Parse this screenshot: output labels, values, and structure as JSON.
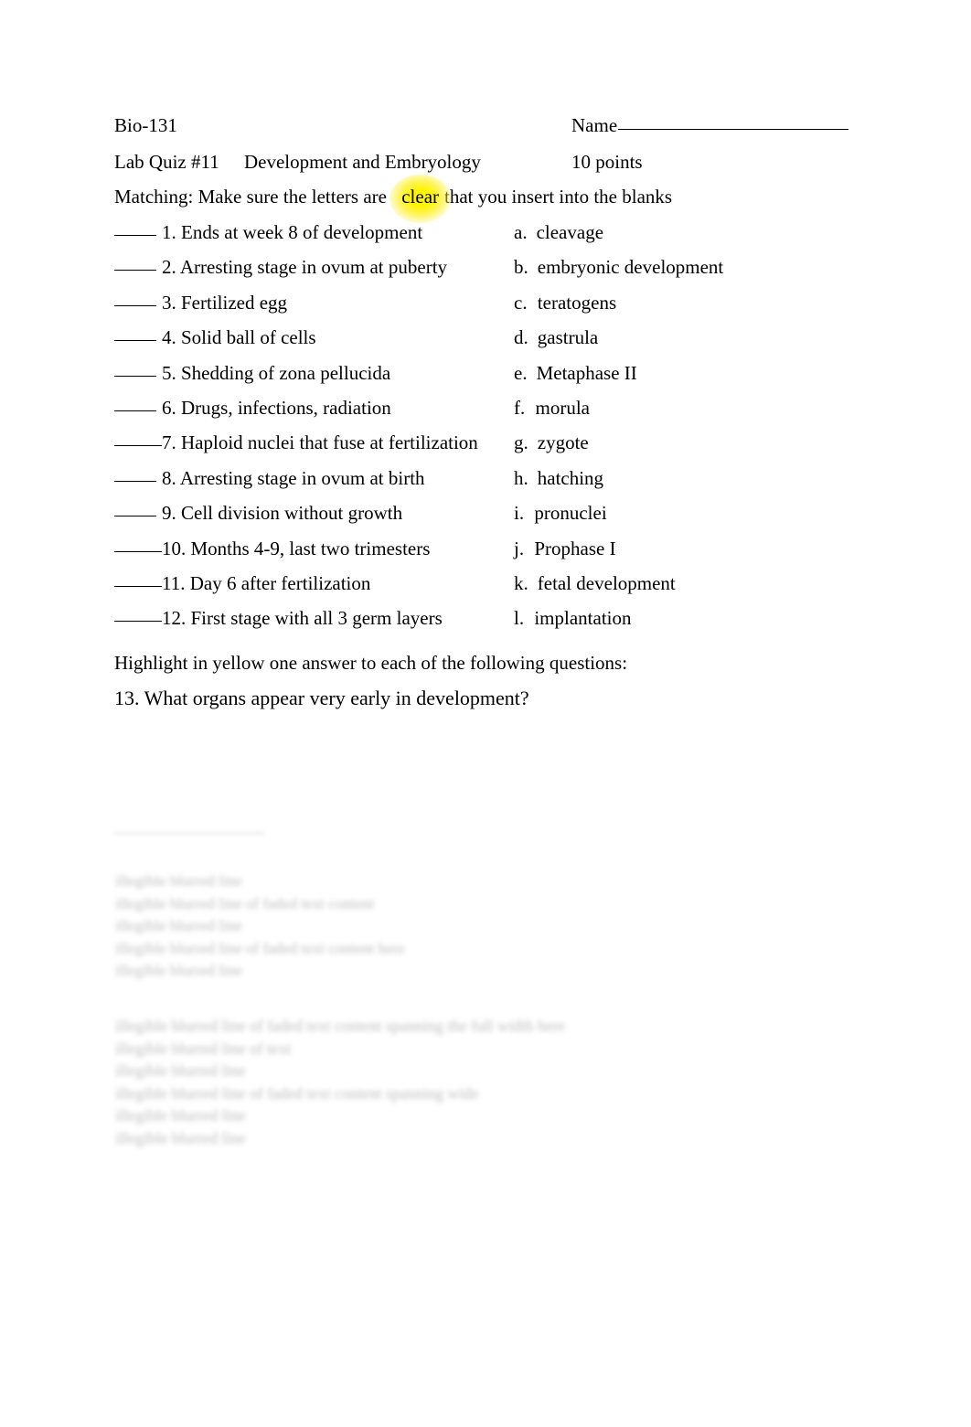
{
  "document": {
    "header": {
      "course": "Bio-131",
      "name_label": "Name",
      "quiz_title": "Lab Quiz #11",
      "quiz_topic": "Development and Embryology",
      "points": "10 points",
      "matching_instructions_before": "Matching: Make sure the letters are",
      "matching_instructions_highlighted": "clear",
      "matching_instructions_after": "that you insert into the blanks",
      "highlight_color": "#FFF800"
    },
    "matching": {
      "items": [
        {
          "number": "1.",
          "text": "Ends at week 8 of development",
          "space_after_blank": true
        },
        {
          "number": "2.",
          "text": "Arresting stage in ovum at puberty",
          "space_after_blank": true
        },
        {
          "number": "3.",
          "text": "Fertilized egg",
          "space_after_blank": true
        },
        {
          "number": "4.",
          "text": "Solid ball of cells",
          "space_after_blank": true
        },
        {
          "number": "5.",
          "text": "Shedding of zona pellucida",
          "space_after_blank": true
        },
        {
          "number": "6.",
          "text": "Drugs, infections, radiation",
          "space_after_blank": true
        },
        {
          "number": "7.",
          "text": "Haploid nuclei that fuse at fertilization",
          "space_after_blank": false
        },
        {
          "number": "8.",
          "text": "Arresting stage in ovum at birth",
          "space_after_blank": true
        },
        {
          "number": "9.",
          "text": "Cell division without growth",
          "space_after_blank": true
        },
        {
          "number": "10.",
          "text": "Months 4-9, last two trimesters",
          "space_after_blank": false
        },
        {
          "number": "11.",
          "text": "Day 6 after fertilization",
          "space_after_blank": false
        },
        {
          "number": "12.",
          "text": "First stage with all 3 germ layers",
          "space_after_blank": false
        }
      ],
      "options": [
        {
          "letter": "a.",
          "text": "cleavage"
        },
        {
          "letter": "b.",
          "text": "embryonic development"
        },
        {
          "letter": "c.",
          "text": "teratogens"
        },
        {
          "letter": "d.",
          "text": "gastrula"
        },
        {
          "letter": "e.",
          "text": "Metaphase II"
        },
        {
          "letter": "f.",
          "text": "morula"
        },
        {
          "letter": "g.",
          "text": "zygote"
        },
        {
          "letter": "h.",
          "text": "hatching"
        },
        {
          "letter": "i.",
          "text": "pronuclei"
        },
        {
          "letter": "j.",
          "text": "Prophase I"
        },
        {
          "letter": "k.",
          "text": "fetal development"
        },
        {
          "letter": "l.",
          "text": "implantation"
        }
      ]
    },
    "prompts": {
      "highlight_instruction": "Highlight in yellow one answer to each of the following questions:",
      "question_13": "13. What organs appear very early in development?"
    },
    "faded_content": {
      "note": "illegible",
      "block_1_lines": [
        "illegible blurred line",
        "illegible blurred line of faded text content",
        "illegible blurred line",
        "illegible blurred line of faded text content here",
        "illegible blurred line"
      ],
      "block_2_lines": [
        "illegible blurred line of faded text content spanning the full width here",
        "illegible blurred line of text",
        "illegible blurred line",
        "illegible blurred line of faded text content spanning wide",
        "illegible blurred line",
        "illegible blurred line"
      ]
    }
  }
}
